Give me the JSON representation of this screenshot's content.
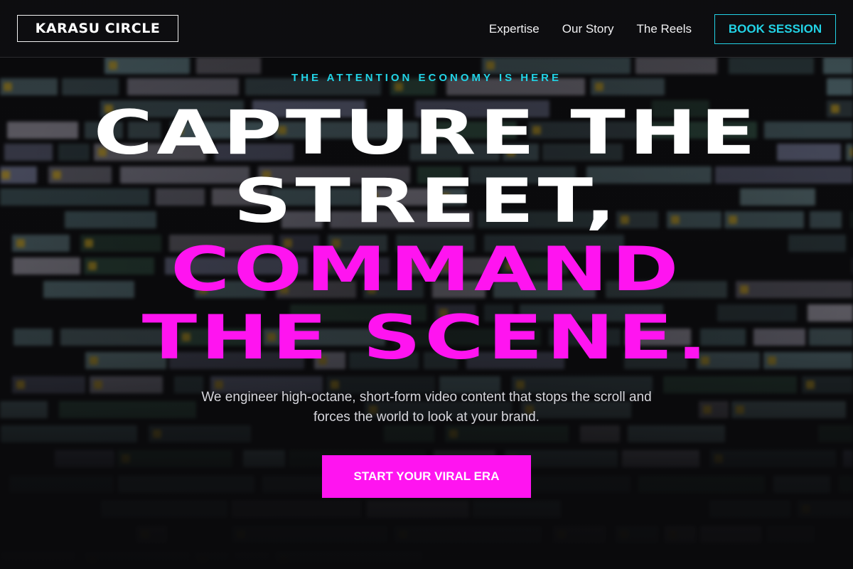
{
  "header": {
    "logo_text": "KARASU CIRCLE",
    "nav": [
      {
        "label": "Expertise"
      },
      {
        "label": "Our Story"
      },
      {
        "label": "The Reels"
      }
    ],
    "cta_label": "BOOK SESSION"
  },
  "hero": {
    "eyebrow": "THE ATTENTION ECONOMY IS HERE",
    "headline_lines": [
      "CAPTURE THE",
      "STREET,",
      "COMMAND",
      "THE SCENE."
    ],
    "subtitle": "We engineer high-octane, short-form video content that stops the scroll and forces the world to look at your brand.",
    "cta_label": "START YOUR VIRAL ERA"
  },
  "colors": {
    "accent_cyan": "#22d3e6",
    "accent_magenta": "#ff14f0",
    "background": "#0b0b0d"
  }
}
